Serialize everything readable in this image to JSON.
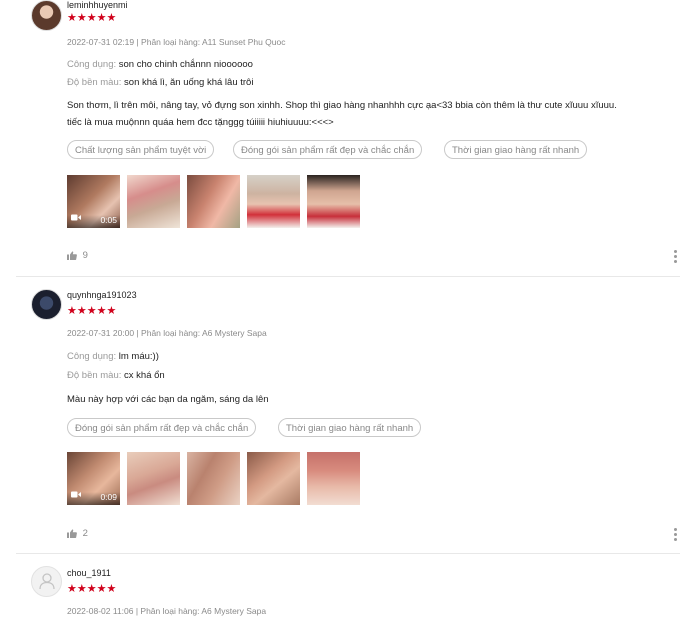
{
  "reviews": [
    {
      "username": "leminhhuyenmi",
      "stars": "★★★★★",
      "meta": "2022-07-31 02:19 | Phân loại hàng: A11 Sunset Phu Quoc",
      "attr1_key": "Công dụng:",
      "attr1_val": "son cho chinh chắnnn nioooooo",
      "attr2_key": "Độ bền màu:",
      "attr2_val": "son khá lì, ăn uống khá lâu trôi",
      "text_line1": "Son thơm, lì trên môi, nâng tay, vỏ đựng son xinhh. Shop thì giao hàng nhanhhh cực ạa<33 bbia còn thêm là thư cute xĩuuu xĩuuu.",
      "text_line2": "tiếc là mua muộnnn quáa hem đcc tặnggg túiiiii hiuhiuuuu:<<<>",
      "tags": [
        "Chất lượng sản phẩm tuyệt vời",
        "Đóng gói sản phẩm rất đẹp và chắc chắn",
        "Thời gian giao hàng rất nhanh"
      ],
      "video_duration": "0:05",
      "likes": "9"
    },
    {
      "username": "quynhnga191023",
      "stars": "★★★★★",
      "meta": "2022-07-31 20:00 | Phân loại hàng: A6 Mystery Sapa",
      "attr1_key": "Công dụng:",
      "attr1_val": "lm máu:))",
      "attr2_key": "Độ bền màu:",
      "attr2_val": "cx khá ổn",
      "text_line1": "Màu này hợp với các bạn da ngăm, sáng da lên",
      "tags": [
        "Đóng gói sản phẩm rất đẹp và chắc chắn",
        "Thời gian giao hàng rất nhanh"
      ],
      "video_duration": "0:09",
      "likes": "2"
    },
    {
      "username": "chou_1911",
      "stars": "★★★★★",
      "meta": "2022-08-02 11:06 | Phân loại hàng: A6 Mystery Sapa"
    }
  ],
  "colors": {
    "star": "#d0011b",
    "muted": "#8a8a8a",
    "tag_border": "#c9c9c9"
  },
  "icons": [
    "video-camera-icon",
    "thumbs-up-icon",
    "more-options-icon",
    "default-avatar-icon"
  ]
}
